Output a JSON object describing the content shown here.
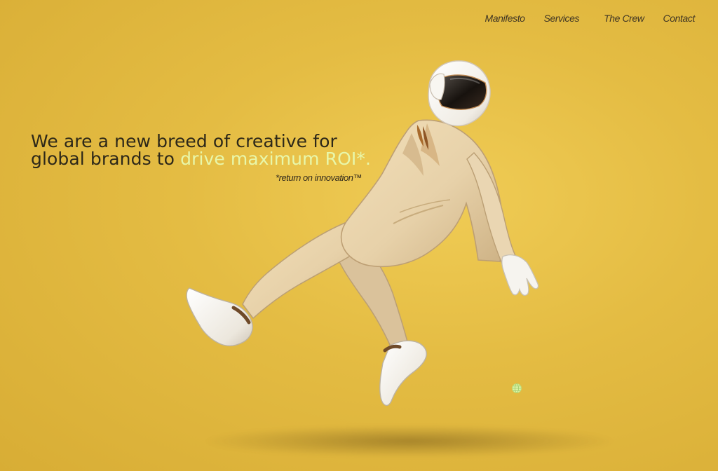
{
  "nav": {
    "items": [
      {
        "label": "Manifesto"
      },
      {
        "label": "Services"
      },
      {
        "label": "The Crew"
      },
      {
        "label": "Contact"
      }
    ]
  },
  "hero": {
    "headline_line1": "We are a new breed of creative for",
    "headline_line2": "global brands to ",
    "headline_highlight": "drive maximum ROI*.",
    "footnote": "*return on innovation™"
  },
  "colors": {
    "background": "#e4bc43",
    "headline_text": "#2d2819",
    "highlight_text": "#e8f7aa",
    "nav_text": "#3f3524"
  },
  "icons": {
    "floating_icon": "globe-icon"
  }
}
